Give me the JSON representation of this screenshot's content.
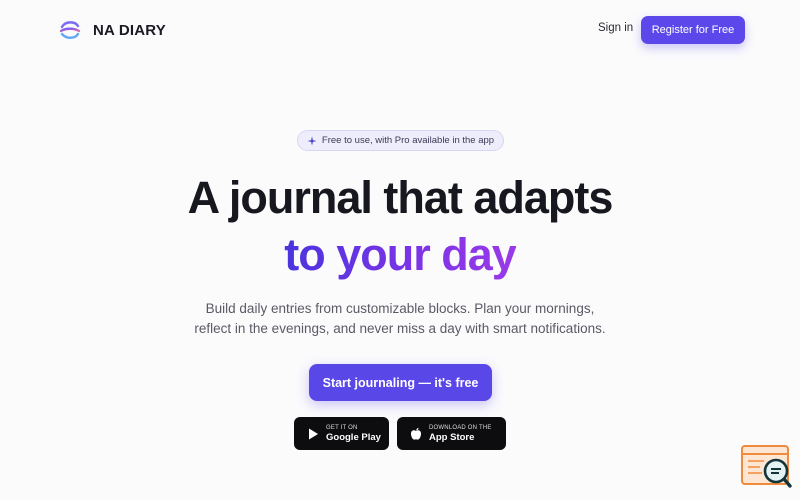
{
  "brand": {
    "name": "NA DIARY",
    "logo_icon": "swirl-logo-icon"
  },
  "nav": {
    "signin_label": "Sign in",
    "register_label": "Register for Free"
  },
  "hero": {
    "badge": "Free to use, with Pro available in the app",
    "badge_icon": "sparkle-icon",
    "title_line1": "A journal that adapts",
    "title_line2": "to your day",
    "subtitle_line1": "Build daily entries from customizable blocks. Plan your mornings,",
    "subtitle_line2": "reflect in the evenings, and never miss a day with smart notifications.",
    "cta_label": "Start journaling — it's free"
  },
  "stores": {
    "google": {
      "small": "GET IT ON",
      "big": "Google Play",
      "icon": "play-icon"
    },
    "apple": {
      "small": "DOWNLOAD ON THE",
      "big": "App Store",
      "icon": "apple-icon"
    }
  },
  "colors": {
    "accent": "#5b47ea",
    "gradient_end": "#9a3ae8",
    "background": "#fbfbfc"
  }
}
